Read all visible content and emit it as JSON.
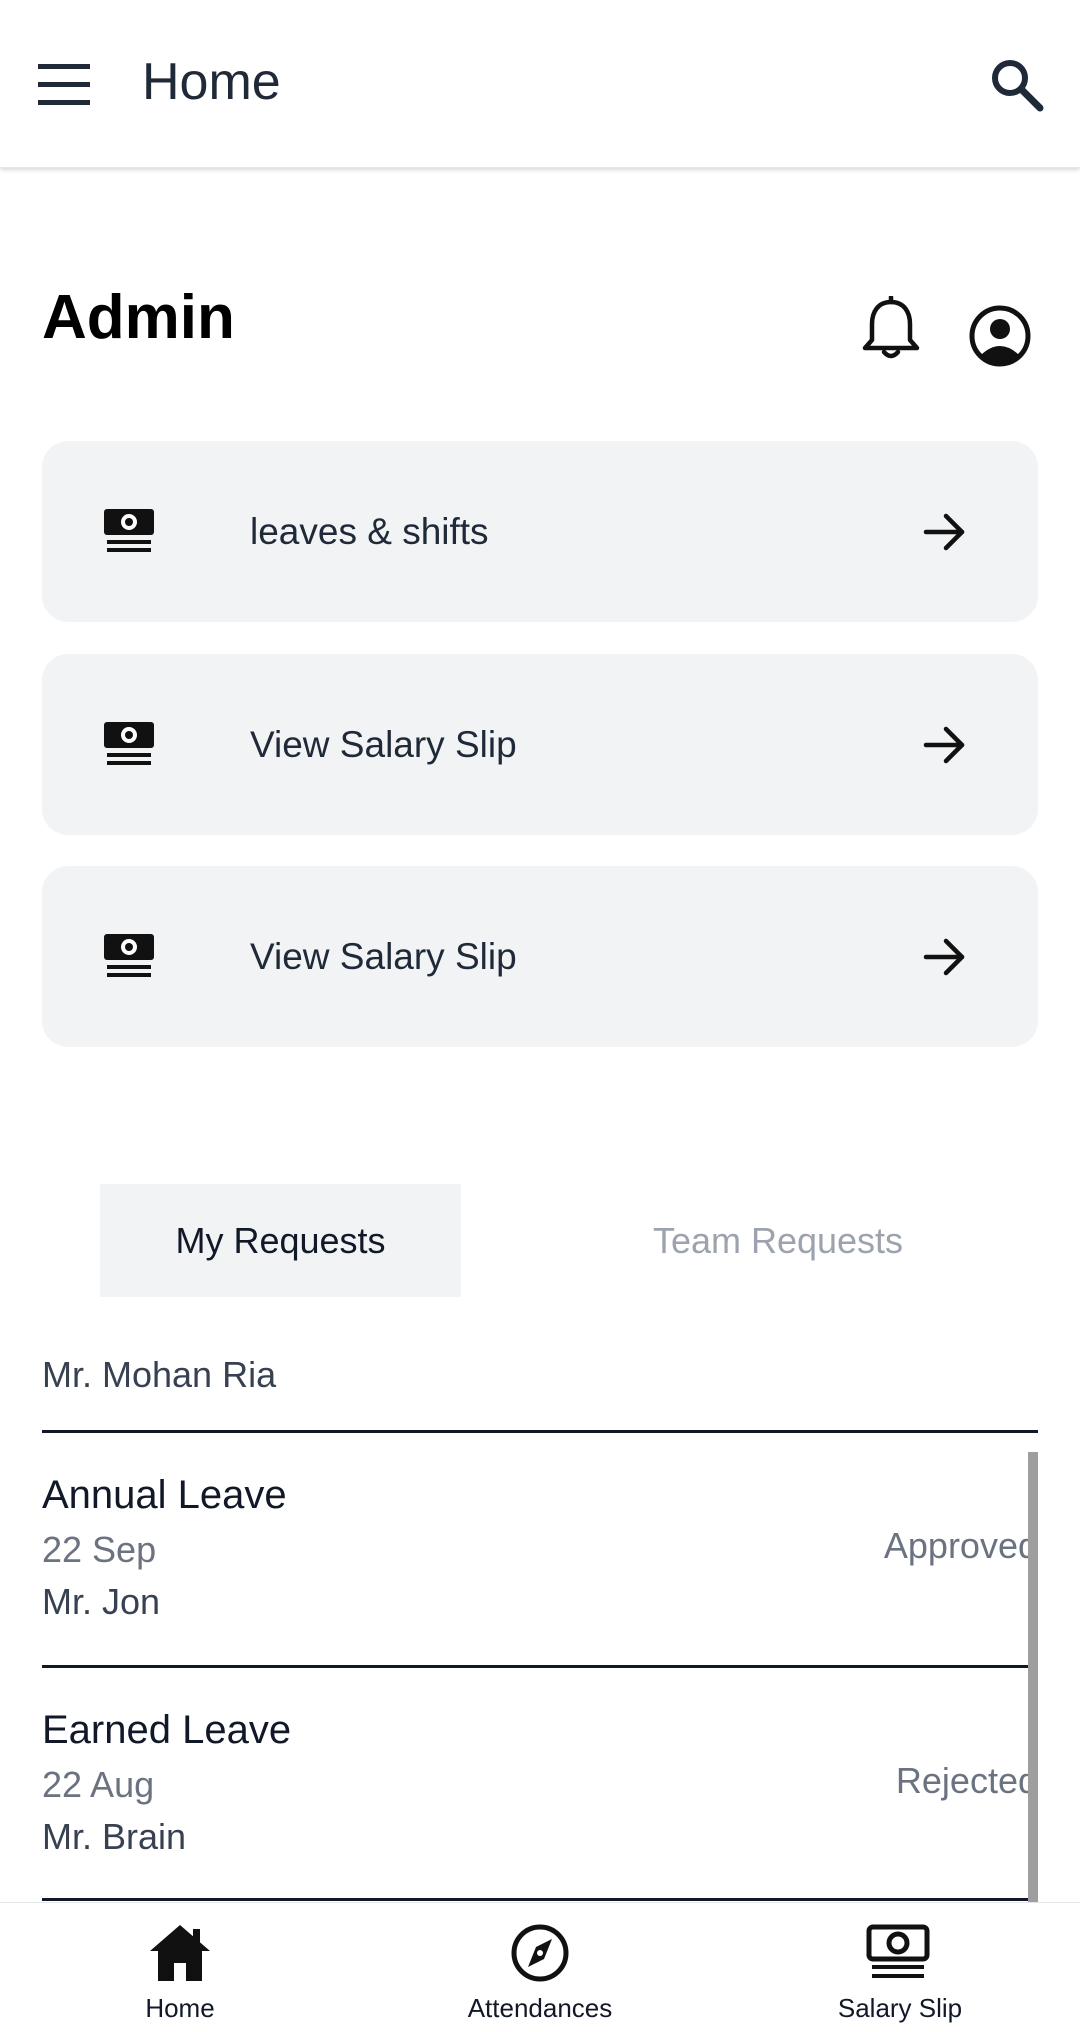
{
  "appbar": {
    "title": "Home",
    "menu_icon": "menu-icon",
    "search_icon": "search-icon"
  },
  "header": {
    "title": "Admin",
    "notification_icon": "bell-icon",
    "account_icon": "account-circle-icon"
  },
  "cards": [
    {
      "label": "leaves & shifts",
      "icon": "cash-icon",
      "arrow_icon": "arrow-right-icon"
    },
    {
      "label": "View Salary Slip",
      "icon": "cash-icon",
      "arrow_icon": "arrow-right-icon"
    },
    {
      "label": "View Salary Slip",
      "icon": "cash-icon",
      "arrow_icon": "arrow-right-icon"
    }
  ],
  "tabs": [
    {
      "label": "My Requests",
      "active": true
    },
    {
      "label": "Team Requests",
      "active": false
    }
  ],
  "requests": [
    {
      "title": "",
      "date": "",
      "name": "Mr. Mohan Ria",
      "status": ""
    },
    {
      "title": "Annual Leave",
      "date": "22 Sep",
      "name": "Mr. Jon",
      "status": "Approved"
    },
    {
      "title": "Earned Leave",
      "date": "22 Aug",
      "name": "Mr. Brain",
      "status": "Rejected"
    }
  ],
  "bottom_nav": [
    {
      "label": "Home",
      "icon": "home-icon"
    },
    {
      "label": "Attendances",
      "icon": "compass-icon"
    },
    {
      "label": "Salary Slip",
      "icon": "cash-icon"
    }
  ],
  "colors": {
    "card_bg": "#f1f3f5",
    "inactive_tab": "#9ca3af",
    "divider": "#111827"
  }
}
